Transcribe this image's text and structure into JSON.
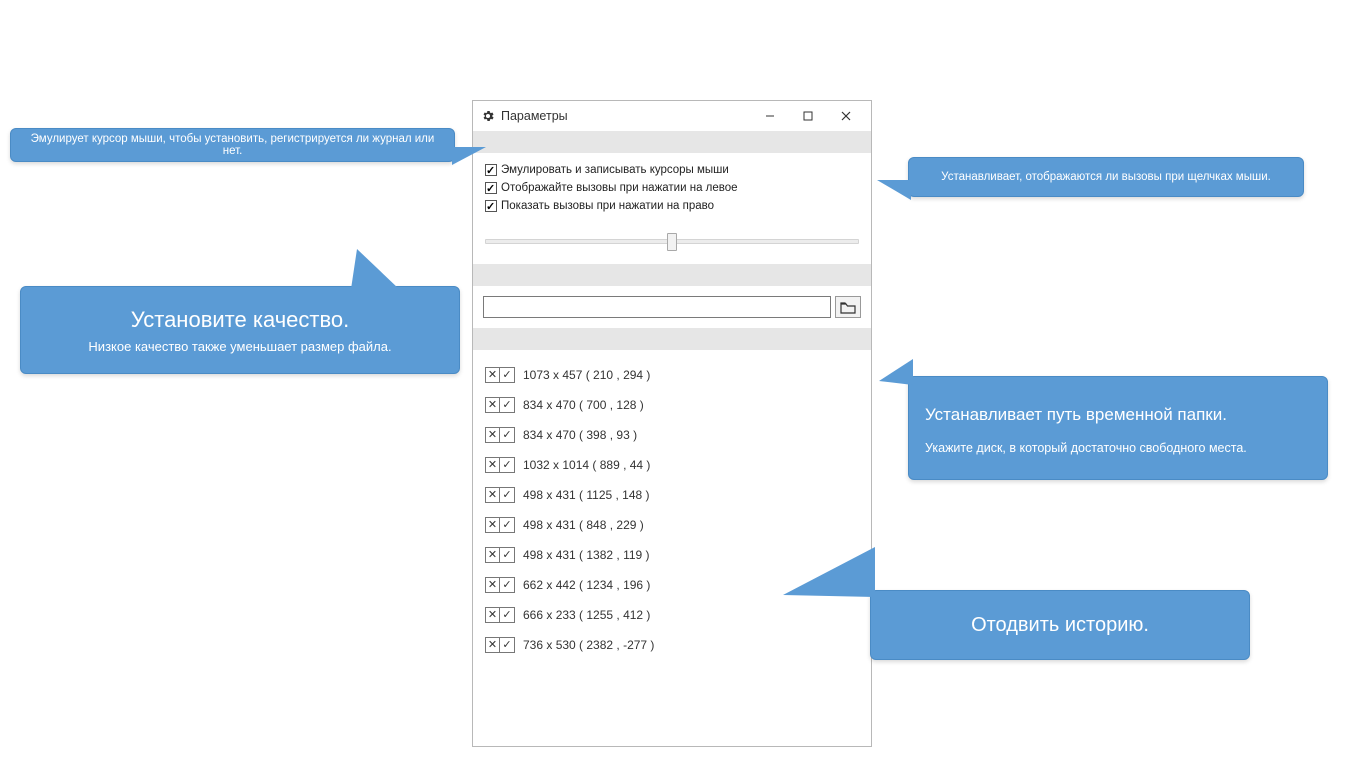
{
  "window": {
    "title": "Параметры"
  },
  "checkboxes": {
    "c1": "Эмулировать и записывать курсоры мыши",
    "c2": "Отображайте вызовы при нажатии на левое",
    "c3": "Показать вызовы при нажатии на право"
  },
  "history": {
    "rows": [
      "1073 x 457 ( 210 , 294 )",
      "834 x 470 ( 700 , 128 )",
      "834 x 470 ( 398 , 93 )",
      "1032 x 1014 ( 889 , 44 )",
      "498 x 431 ( 1125 , 148 )",
      "498 x 431 ( 848 , 229 )",
      "498 x 431 ( 1382 , 119 )",
      "662 x 442 ( 1234 , 196 )",
      "666 x 233 ( 1255 , 412 )",
      "736 x 530 ( 2382 , -277 )"
    ]
  },
  "callouts": {
    "co1": "Эмулирует курсор мыши, чтобы установить, регистрируется ли журнал или нет.",
    "co2_title": "Установите качество.",
    "co2_sub": "Низкое качество также уменьшает размер файла.",
    "co3": "Устанавливает, отображаются ли вызовы при щелчках мыши.",
    "co4_title": "Устанавливает путь временной папки.",
    "co4_sub": "Укажите диск, в который достаточно свободного места.",
    "co5_title": "Отодвить историю."
  }
}
